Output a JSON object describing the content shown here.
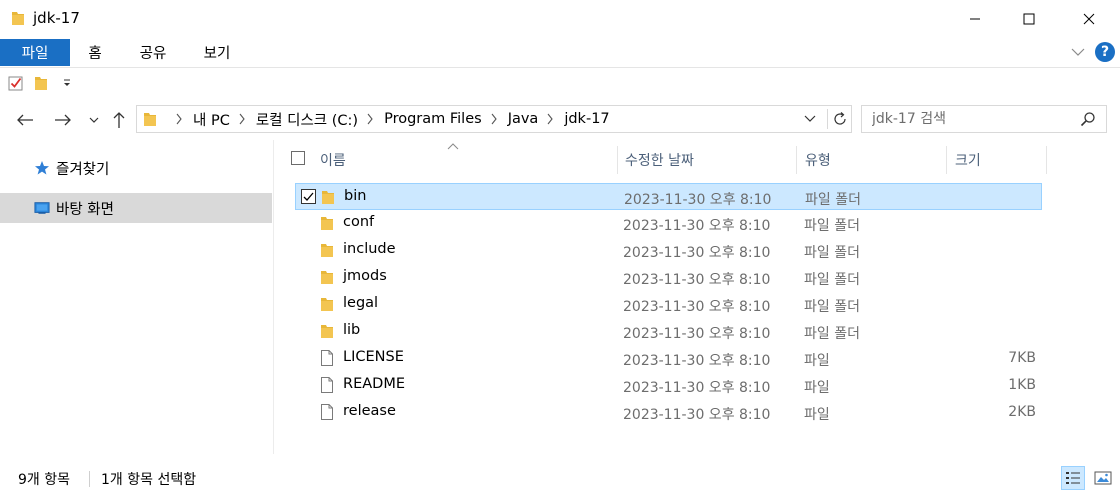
{
  "window": {
    "title": "jdk-17",
    "title_icon": "folder-icon",
    "controls": [
      "minimize-icon",
      "maximize-icon",
      "close-icon"
    ]
  },
  "ribbon": {
    "tabs": [
      {
        "label": "파일"
      },
      {
        "label": "홈"
      },
      {
        "label": "공유"
      },
      {
        "label": "보기"
      }
    ],
    "help_label": "?"
  },
  "quick_access": {
    "icons": [
      "properties-check-icon",
      "new-folder-icon",
      "customize-dropdown-icon"
    ]
  },
  "navigation": {
    "breadcrumbs": [
      "내 PC",
      "로컬 디스크 (C:)",
      "Program Files",
      "Java",
      "jdk-17"
    ],
    "search_placeholder": "jdk-17 검색"
  },
  "nav_pane": {
    "items": [
      {
        "label": "즐겨찾기",
        "icon": "star-icon"
      },
      {
        "label": "바탕 화면",
        "icon": "desktop-icon"
      }
    ]
  },
  "file_list": {
    "columns": {
      "name": "이름",
      "date": "수정한 날짜",
      "type": "유형",
      "size": "크기"
    },
    "rows": [
      {
        "name": "bin",
        "date": "2023-11-30 오후 8:10",
        "type": "파일 폴더",
        "size": "",
        "kind": "folder",
        "selected": true
      },
      {
        "name": "conf",
        "date": "2023-11-30 오후 8:10",
        "type": "파일 폴더",
        "size": "",
        "kind": "folder",
        "selected": false
      },
      {
        "name": "include",
        "date": "2023-11-30 오후 8:10",
        "type": "파일 폴더",
        "size": "",
        "kind": "folder",
        "selected": false
      },
      {
        "name": "jmods",
        "date": "2023-11-30 오후 8:10",
        "type": "파일 폴더",
        "size": "",
        "kind": "folder",
        "selected": false
      },
      {
        "name": "legal",
        "date": "2023-11-30 오후 8:10",
        "type": "파일 폴더",
        "size": "",
        "kind": "folder",
        "selected": false
      },
      {
        "name": "lib",
        "date": "2023-11-30 오후 8:10",
        "type": "파일 폴더",
        "size": "",
        "kind": "folder",
        "selected": false
      },
      {
        "name": "LICENSE",
        "date": "2023-11-30 오후 8:10",
        "type": "파일",
        "size": "7KB",
        "kind": "file",
        "selected": false
      },
      {
        "name": "README",
        "date": "2023-11-30 오후 8:10",
        "type": "파일",
        "size": "1KB",
        "kind": "file",
        "selected": false
      },
      {
        "name": "release",
        "date": "2023-11-30 오후 8:10",
        "type": "파일",
        "size": "2KB",
        "kind": "file",
        "selected": false
      }
    ]
  },
  "status_bar": {
    "item_count": "9개 항목",
    "selected_count": "1개 항목 선택함"
  },
  "colors": {
    "accent": "#1a6fc4",
    "selection_bg": "#cce8ff",
    "selection_border": "#99d1ff",
    "folder": "#f3c551",
    "secondary_text": "#6d6d6d"
  }
}
